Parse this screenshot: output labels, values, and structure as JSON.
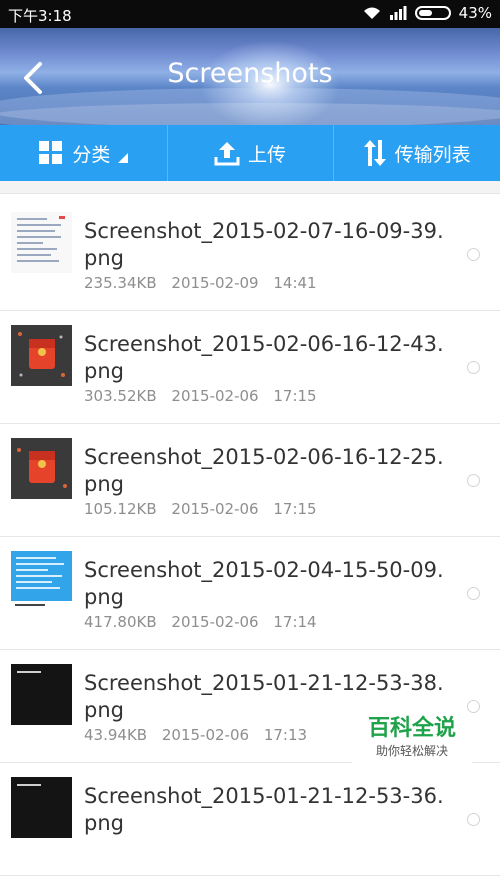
{
  "statusbar": {
    "time": "下午3:18",
    "battery": "43%"
  },
  "header": {
    "title": "Screenshots"
  },
  "toolbar": {
    "category_label": "分类",
    "upload_label": "上传",
    "transfer_label": "传输列表"
  },
  "files": [
    {
      "name": "Screenshot_2015-02-07-16-09-39.png",
      "size": "235.34KB",
      "date": "2015-02-09",
      "time": "14:41"
    },
    {
      "name": "Screenshot_2015-02-06-16-12-43.png",
      "size": "303.52KB",
      "date": "2015-02-06",
      "time": "17:15"
    },
    {
      "name": "Screenshot_2015-02-06-16-12-25.png",
      "size": "105.12KB",
      "date": "2015-02-06",
      "time": "17:15"
    },
    {
      "name": "Screenshot_2015-02-04-15-50-09.png",
      "size": "417.80KB",
      "date": "2015-02-06",
      "time": "17:14"
    },
    {
      "name": "Screenshot_2015-01-21-12-53-38.png",
      "size": "43.94KB",
      "date": "2015-02-06",
      "time": "17:13"
    },
    {
      "name": "Screenshot_2015-01-21-12-53-36.png",
      "size": "",
      "date": "",
      "time": ""
    }
  ],
  "watermark": {
    "title": "百科全说",
    "subtitle": "助你轻松解决"
  },
  "colors": {
    "accent": "#2aa0f3",
    "statusbar": "#0b0b0b",
    "watermark_green": "#1fa34a"
  }
}
